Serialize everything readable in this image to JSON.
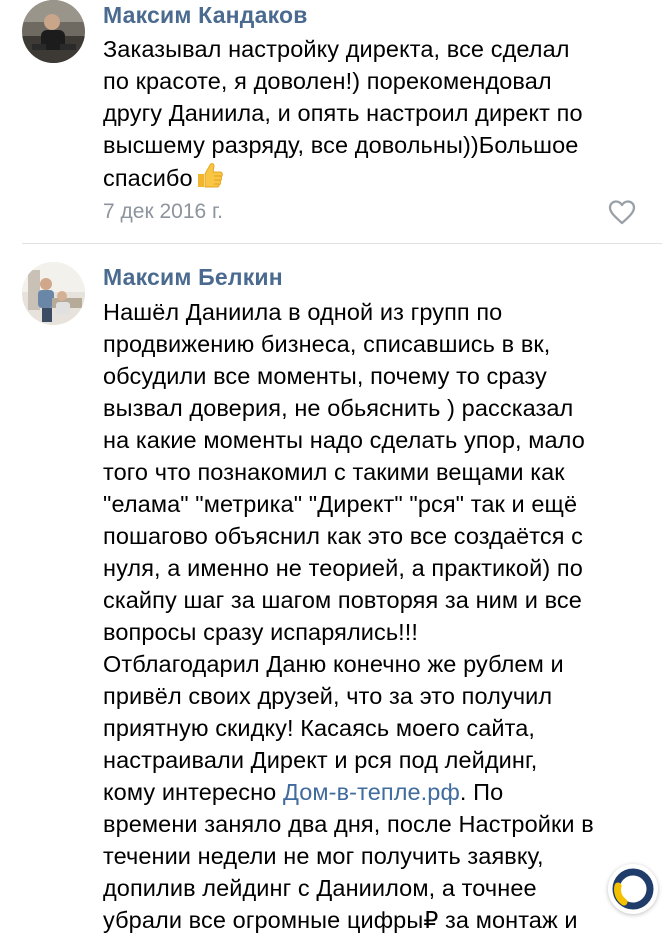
{
  "comments": [
    {
      "author": "Максим Кандаков",
      "lines": [
        "Заказывал настройку директа, все сделал",
        "по красоте, я доволен!) порекомендовал",
        "другу Даниила, и опять настроил директ по",
        "высшему разряду, все довольны))Большое",
        "спасибо"
      ],
      "emoji": "thumbs-up-emoji",
      "date": "7 дек 2016 г.",
      "like_icon": "heart-outline-icon"
    },
    {
      "author": "Максим Белкин",
      "lines": [
        "Нашёл Даниила в одной из групп по",
        "продвижению бизнеса, списавшись в вк,",
        "обсудили все моменты, почему то сразу",
        "вызвал доверия, не обьяснить ) рассказал",
        "на какие моменты надо сделать упор, мало",
        "того что познакомил с такими вещами как",
        "\"елама\" \"метрика\" \"Директ\" \"рся\" так и ещё",
        "пошагово объяснил как это все создаётся с",
        "нуля, а именно не теорией, а практикой) по",
        "скайпу шаг за шагом повторяя за ним и все",
        "вопросы сразу испарялись!!!",
        "Отблагодарил Даню конечно же рублем и",
        "привёл своих друзей, что за это получил",
        "приятную скидку! Касаясь моего сайта,",
        "настраивали Директ и рся под лейдинг,"
      ],
      "link_line": {
        "before": "кому интересно ",
        "link": "Дом-в-тепле.рф",
        "after": ". По"
      },
      "lines_after": [
        "времени заняло два дня, после Настройки в",
        "течении недели не мог получить заявку,",
        "допилив лейдинг с Даниилом, а точнее",
        "убрали все огромные цифры₽ за монтаж и"
      ]
    }
  ],
  "colors": {
    "author": "#4a6b8f",
    "link": "#3f6b9e",
    "date": "#8d949e",
    "divider": "#dfe1e4",
    "badge_blue": "#1f3c6b",
    "badge_yellow": "#f4c000"
  }
}
